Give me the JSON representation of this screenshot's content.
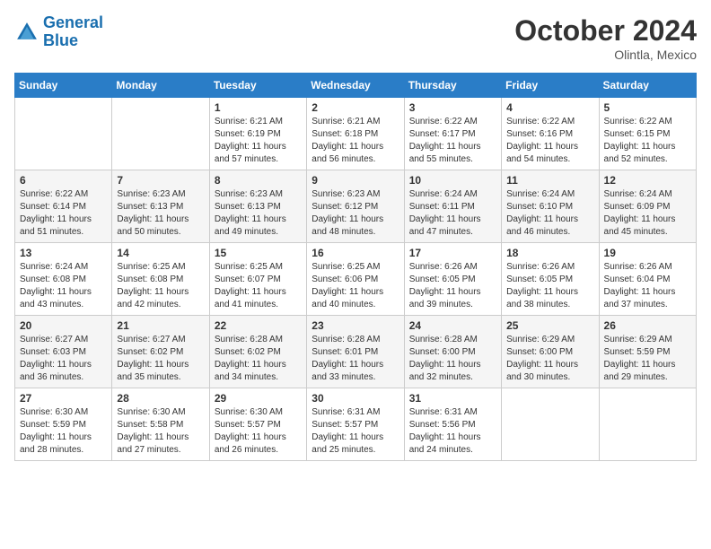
{
  "header": {
    "logo_line1": "General",
    "logo_line2": "Blue",
    "month": "October 2024",
    "location": "Olintla, Mexico"
  },
  "weekdays": [
    "Sunday",
    "Monday",
    "Tuesday",
    "Wednesday",
    "Thursday",
    "Friday",
    "Saturday"
  ],
  "weeks": [
    [
      {
        "day": "",
        "info": ""
      },
      {
        "day": "",
        "info": ""
      },
      {
        "day": "1",
        "info": "Sunrise: 6:21 AM\nSunset: 6:19 PM\nDaylight: 11 hours and 57 minutes."
      },
      {
        "day": "2",
        "info": "Sunrise: 6:21 AM\nSunset: 6:18 PM\nDaylight: 11 hours and 56 minutes."
      },
      {
        "day": "3",
        "info": "Sunrise: 6:22 AM\nSunset: 6:17 PM\nDaylight: 11 hours and 55 minutes."
      },
      {
        "day": "4",
        "info": "Sunrise: 6:22 AM\nSunset: 6:16 PM\nDaylight: 11 hours and 54 minutes."
      },
      {
        "day": "5",
        "info": "Sunrise: 6:22 AM\nSunset: 6:15 PM\nDaylight: 11 hours and 52 minutes."
      }
    ],
    [
      {
        "day": "6",
        "info": "Sunrise: 6:22 AM\nSunset: 6:14 PM\nDaylight: 11 hours and 51 minutes."
      },
      {
        "day": "7",
        "info": "Sunrise: 6:23 AM\nSunset: 6:13 PM\nDaylight: 11 hours and 50 minutes."
      },
      {
        "day": "8",
        "info": "Sunrise: 6:23 AM\nSunset: 6:13 PM\nDaylight: 11 hours and 49 minutes."
      },
      {
        "day": "9",
        "info": "Sunrise: 6:23 AM\nSunset: 6:12 PM\nDaylight: 11 hours and 48 minutes."
      },
      {
        "day": "10",
        "info": "Sunrise: 6:24 AM\nSunset: 6:11 PM\nDaylight: 11 hours and 47 minutes."
      },
      {
        "day": "11",
        "info": "Sunrise: 6:24 AM\nSunset: 6:10 PM\nDaylight: 11 hours and 46 minutes."
      },
      {
        "day": "12",
        "info": "Sunrise: 6:24 AM\nSunset: 6:09 PM\nDaylight: 11 hours and 45 minutes."
      }
    ],
    [
      {
        "day": "13",
        "info": "Sunrise: 6:24 AM\nSunset: 6:08 PM\nDaylight: 11 hours and 43 minutes."
      },
      {
        "day": "14",
        "info": "Sunrise: 6:25 AM\nSunset: 6:08 PM\nDaylight: 11 hours and 42 minutes."
      },
      {
        "day": "15",
        "info": "Sunrise: 6:25 AM\nSunset: 6:07 PM\nDaylight: 11 hours and 41 minutes."
      },
      {
        "day": "16",
        "info": "Sunrise: 6:25 AM\nSunset: 6:06 PM\nDaylight: 11 hours and 40 minutes."
      },
      {
        "day": "17",
        "info": "Sunrise: 6:26 AM\nSunset: 6:05 PM\nDaylight: 11 hours and 39 minutes."
      },
      {
        "day": "18",
        "info": "Sunrise: 6:26 AM\nSunset: 6:05 PM\nDaylight: 11 hours and 38 minutes."
      },
      {
        "day": "19",
        "info": "Sunrise: 6:26 AM\nSunset: 6:04 PM\nDaylight: 11 hours and 37 minutes."
      }
    ],
    [
      {
        "day": "20",
        "info": "Sunrise: 6:27 AM\nSunset: 6:03 PM\nDaylight: 11 hours and 36 minutes."
      },
      {
        "day": "21",
        "info": "Sunrise: 6:27 AM\nSunset: 6:02 PM\nDaylight: 11 hours and 35 minutes."
      },
      {
        "day": "22",
        "info": "Sunrise: 6:28 AM\nSunset: 6:02 PM\nDaylight: 11 hours and 34 minutes."
      },
      {
        "day": "23",
        "info": "Sunrise: 6:28 AM\nSunset: 6:01 PM\nDaylight: 11 hours and 33 minutes."
      },
      {
        "day": "24",
        "info": "Sunrise: 6:28 AM\nSunset: 6:00 PM\nDaylight: 11 hours and 32 minutes."
      },
      {
        "day": "25",
        "info": "Sunrise: 6:29 AM\nSunset: 6:00 PM\nDaylight: 11 hours and 30 minutes."
      },
      {
        "day": "26",
        "info": "Sunrise: 6:29 AM\nSunset: 5:59 PM\nDaylight: 11 hours and 29 minutes."
      }
    ],
    [
      {
        "day": "27",
        "info": "Sunrise: 6:30 AM\nSunset: 5:59 PM\nDaylight: 11 hours and 28 minutes."
      },
      {
        "day": "28",
        "info": "Sunrise: 6:30 AM\nSunset: 5:58 PM\nDaylight: 11 hours and 27 minutes."
      },
      {
        "day": "29",
        "info": "Sunrise: 6:30 AM\nSunset: 5:57 PM\nDaylight: 11 hours and 26 minutes."
      },
      {
        "day": "30",
        "info": "Sunrise: 6:31 AM\nSunset: 5:57 PM\nDaylight: 11 hours and 25 minutes."
      },
      {
        "day": "31",
        "info": "Sunrise: 6:31 AM\nSunset: 5:56 PM\nDaylight: 11 hours and 24 minutes."
      },
      {
        "day": "",
        "info": ""
      },
      {
        "day": "",
        "info": ""
      }
    ]
  ]
}
